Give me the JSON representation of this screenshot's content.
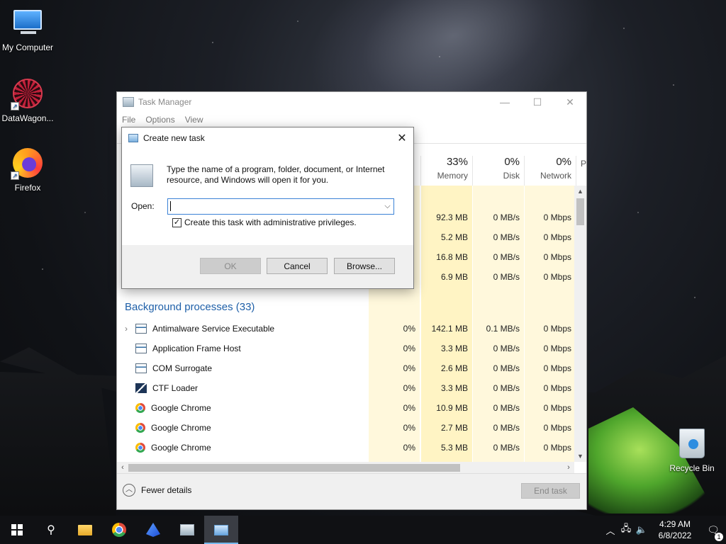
{
  "desktop": {
    "icons": [
      {
        "label": "My Computer"
      },
      {
        "label": "DataWagon..."
      },
      {
        "label": "Firefox"
      },
      {
        "label": "Recycle Bin"
      }
    ]
  },
  "task_manager": {
    "title": "Task Manager",
    "menu": [
      "File",
      "Options",
      "View"
    ],
    "columns": [
      {
        "pct": "33%",
        "label": "Memory"
      },
      {
        "pct": "0%",
        "label": "Disk"
      },
      {
        "pct": "0%",
        "label": "Network"
      },
      {
        "pct": "",
        "label": "P"
      }
    ],
    "apps_rows": [
      {
        "memory": "92.3 MB",
        "disk": "0 MB/s",
        "network": "0 Mbps"
      },
      {
        "memory": "5.2 MB",
        "disk": "0 MB/s",
        "network": "0 Mbps"
      },
      {
        "memory": "16.8 MB",
        "disk": "0 MB/s",
        "network": "0 Mbps"
      },
      {
        "memory": "6.9 MB",
        "disk": "0 MB/s",
        "network": "0 Mbps"
      }
    ],
    "background_title": "Background processes (33)",
    "processes": [
      {
        "name": "Antimalware Service Executable",
        "cpu": "0%",
        "memory": "142.1 MB",
        "disk": "0.1 MB/s",
        "network": "0 Mbps",
        "icon": "service-icon",
        "expandable": true
      },
      {
        "name": "Application Frame Host",
        "cpu": "0%",
        "memory": "3.3 MB",
        "disk": "0 MB/s",
        "network": "0 Mbps",
        "icon": "service-icon",
        "expandable": false
      },
      {
        "name": "COM Surrogate",
        "cpu": "0%",
        "memory": "2.6 MB",
        "disk": "0 MB/s",
        "network": "0 Mbps",
        "icon": "service-icon",
        "expandable": false
      },
      {
        "name": "CTF Loader",
        "cpu": "0%",
        "memory": "3.3 MB",
        "disk": "0 MB/s",
        "network": "0 Mbps",
        "icon": "ctf-icon",
        "expandable": false
      },
      {
        "name": "Google Chrome",
        "cpu": "0%",
        "memory": "10.9 MB",
        "disk": "0 MB/s",
        "network": "0 Mbps",
        "icon": "chrome-icon",
        "expandable": false
      },
      {
        "name": "Google Chrome",
        "cpu": "0%",
        "memory": "2.7 MB",
        "disk": "0 MB/s",
        "network": "0 Mbps",
        "icon": "chrome-icon",
        "expandable": false
      },
      {
        "name": "Google Chrome",
        "cpu": "0%",
        "memory": "5.3 MB",
        "disk": "0 MB/s",
        "network": "0 Mbps",
        "icon": "chrome-icon",
        "expandable": false
      }
    ],
    "fewer_details": "Fewer details",
    "end_task": "End task"
  },
  "dialog": {
    "title": "Create new task",
    "message": "Type the name of a program, folder, document, or Internet resource, and Windows will open it for you.",
    "open_label": "Open:",
    "open_value": "",
    "admin_label": "Create this task with administrative privileges.",
    "admin_checked": true,
    "ok": "OK",
    "cancel": "Cancel",
    "browse": "Browse..."
  },
  "taskbar": {
    "time": "4:29 AM",
    "date": "6/8/2022",
    "notifications": "1"
  },
  "colors": {
    "heat": "#fff4c4",
    "accent": "#1e5fa8",
    "taskbar": "#101114"
  }
}
